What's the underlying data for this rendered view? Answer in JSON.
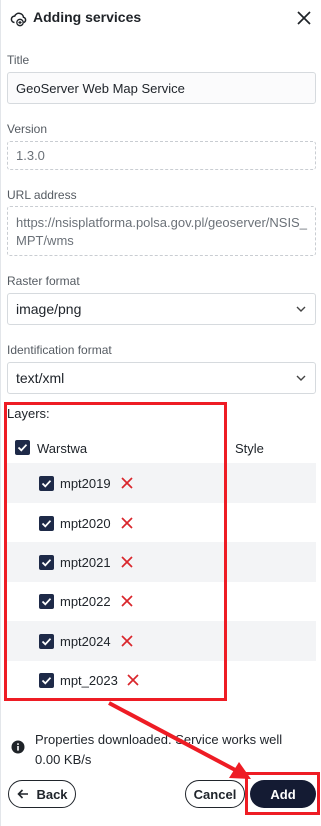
{
  "header": {
    "title": "Adding services",
    "icon": "cloud-add-icon",
    "close_icon": "close-icon"
  },
  "form": {
    "title_label": "Title",
    "title_value": "GeoServer Web Map Service",
    "version_label": "Version",
    "version_value": "1.3.0",
    "url_label": "URL address",
    "url_line1": "https://nsisplatforma.polsa.gov.pl/geoserver/NSIS_",
    "url_line2": "MPT/wms",
    "raster_label": "Raster format",
    "raster_value": "image/png",
    "ident_label": "Identification format",
    "ident_value": "text/xml"
  },
  "layers": {
    "title": "Layers:",
    "col_name": "Warstwa",
    "col_style": "Style",
    "rows": [
      {
        "name": "mpt2019",
        "checked": true
      },
      {
        "name": "mpt2020",
        "checked": true
      },
      {
        "name": "mpt2021",
        "checked": true
      },
      {
        "name": "mpt2022",
        "checked": true
      },
      {
        "name": "mpt2024",
        "checked": true
      },
      {
        "name": "mpt_2023",
        "checked": true
      }
    ]
  },
  "status": {
    "line1": "Properties downloaded. Service works well",
    "line2": "0.00 KB/s",
    "icon": "info-icon"
  },
  "buttons": {
    "back": "Back",
    "cancel": "Cancel",
    "add": "Add"
  },
  "colors": {
    "accent": "#141b33",
    "highlight": "#ee1c24",
    "delete": "#d9262c"
  }
}
